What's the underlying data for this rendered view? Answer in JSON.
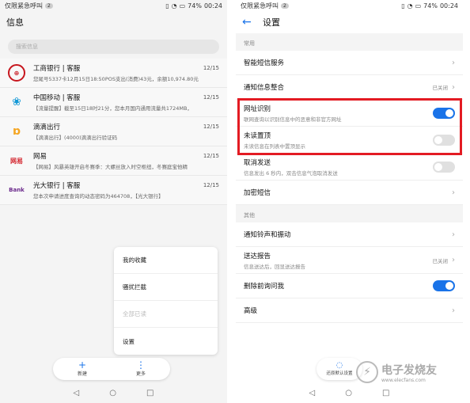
{
  "left": {
    "status": {
      "left": "仅限紧急呼叫",
      "badge": "2",
      "battery": "74%",
      "time": "00:24"
    },
    "title": "信息",
    "search_placeholder": "搜索信息",
    "conversations": [
      {
        "name": "工商银行 | 客服",
        "date": "12/15",
        "snippet": "您尾号5337卡12月15日18:50POS支出(消费)43元，余额10,974.80元",
        "avatar_text": "",
        "avatar_color": "#c7161e"
      },
      {
        "name": "中国移动 | 客服",
        "date": "12/15",
        "snippet": "【流量提醒】截至15日18时21分，您本月国内通用流量共1724MB，",
        "avatar_text": "",
        "avatar_color": "#1298d6"
      },
      {
        "name": "滴滴出行",
        "date": "12/15",
        "snippet": "【滴滴出行】(4000)滴滴出行验证码",
        "avatar_text": "",
        "avatar_color": "#f5a623"
      },
      {
        "name": "网易",
        "date": "12/15",
        "snippet": "【网易】风暴英雄开启冬赛季：大螺丝放入时空枢纽，冬赛庭宝他精",
        "avatar_text": "网易",
        "avatar_color": "#d3232c"
      },
      {
        "name": "光大银行 | 客服",
        "date": "12/15",
        "snippet": "您本次申请进度查询的动态密码为464708，【光大银行】",
        "avatar_text": "Bank",
        "avatar_color": "#6b2a8c"
      }
    ],
    "menu": [
      "我的收藏",
      "骚扰拦截",
      "全部已读",
      "设置"
    ],
    "fab": {
      "new_label": "新建",
      "more_label": "更多"
    }
  },
  "right": {
    "status": {
      "left": "仅限紧急呼叫",
      "badge": "2",
      "battery": "74%",
      "time": "00:24"
    },
    "title": "设置",
    "sections": {
      "common": "常用",
      "other": "其他"
    },
    "rows": {
      "smart_sms": {
        "label": "智能短信服务"
      },
      "notify_merge": {
        "label": "通知信息整合",
        "status": "已关闭"
      },
      "url_detect": {
        "label": "网址识别",
        "sub": "联网查询以识别信息中的恶意和非官方网址"
      },
      "unread_top": {
        "label": "未读置顶",
        "sub": "未读信息在列表中置顶显示"
      },
      "cancel_send": {
        "label": "取消发送",
        "sub": "信息发出 6 秒内，双击信息气泡取消发送"
      },
      "encrypt": {
        "label": "加密短信"
      },
      "ringtone": {
        "label": "通知铃声和振动"
      },
      "report": {
        "label": "送达报告",
        "sub": "信息送达后，回显送达报告",
        "status": "已关闭"
      },
      "delete_ask": {
        "label": "删除前询问我"
      },
      "advanced": {
        "label": "高级"
      }
    },
    "restore_label": "还原默认设置"
  },
  "watermark": {
    "cn": "电子发烧友",
    "url": "www.elecfans.com"
  },
  "colors": {
    "accent": "#1a73e8",
    "highlight": "#e31b23"
  }
}
